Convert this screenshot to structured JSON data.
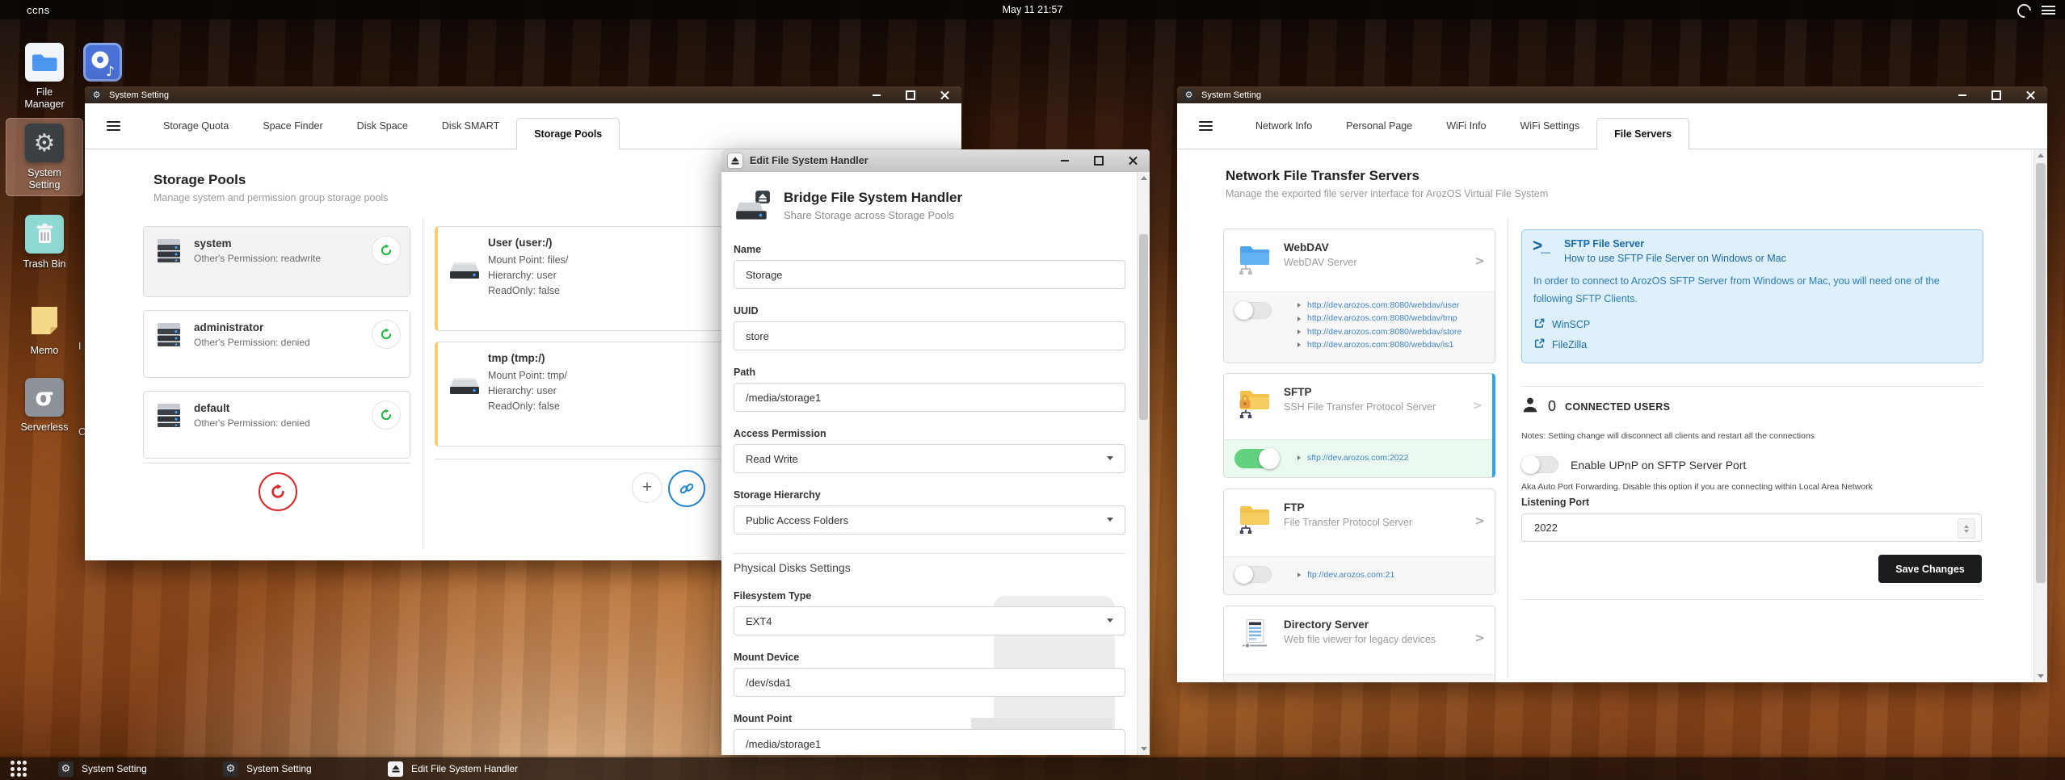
{
  "topbar": {
    "host": "ccns",
    "clock": "May 11 21:57"
  },
  "desktop": {
    "icons": [
      {
        "key": "file-manager",
        "label": "File Manager",
        "selected": false
      },
      {
        "key": "system-setting",
        "label": "System Setting",
        "selected": true
      },
      {
        "key": "trash-bin",
        "label": "Trash Bin",
        "selected": false
      },
      {
        "key": "memo",
        "label": "Memo",
        "selected": false
      },
      {
        "key": "serverless",
        "label": "Serverless",
        "selected": false
      }
    ],
    "music_icon": "music-player",
    "clipped_labels": [
      "I",
      "C"
    ]
  },
  "win1": {
    "title": "System Setting",
    "tabs": [
      "Storage Quota",
      "Space Finder",
      "Disk Space",
      "Disk SMART",
      "Storage Pools"
    ],
    "active_tab": "Storage Pools",
    "heading": "Storage Pools",
    "subheading": "Manage system and permission group storage pools",
    "pools": [
      {
        "name": "system",
        "perm": "Other's Permission: readwrite",
        "selected": true
      },
      {
        "name": "administrator",
        "perm": "Other's Permission: denied",
        "selected": false
      },
      {
        "name": "default",
        "perm": "Other's Permission: denied",
        "selected": false
      }
    ],
    "mounts": [
      {
        "name": "User (user:/)",
        "lines": [
          "Mount Point: files/",
          "Hierarchy: user",
          "ReadOnly: false"
        ]
      },
      {
        "name": "tmp (tmp:/)",
        "lines": [
          "Mount Point: tmp/",
          "Hierarchy: user",
          "ReadOnly: false"
        ]
      }
    ]
  },
  "dialog": {
    "title": "Edit File System Handler",
    "heading": "Bridge File System Handler",
    "subheading": "Share Storage across Storage Pools",
    "fields": [
      {
        "label": "Name",
        "value": "Storage",
        "type": "text"
      },
      {
        "label": "UUID",
        "value": "store",
        "type": "text"
      },
      {
        "label": "Path",
        "value": "/media/storage1",
        "type": "text"
      },
      {
        "label": "Access Permission",
        "value": "Read Write",
        "type": "select"
      },
      {
        "label": "Storage Hierarchy",
        "value": "Public Access Folders",
        "type": "select"
      }
    ],
    "section2": "Physical Disks Settings",
    "fields2": [
      {
        "label": "Filesystem Type",
        "value": "EXT4",
        "type": "select"
      },
      {
        "label": "Mount Device",
        "value": "/dev/sda1",
        "type": "text"
      },
      {
        "label": "Mount Point",
        "value": "/media/storage1",
        "type": "text"
      }
    ]
  },
  "win2": {
    "title": "System Setting",
    "tabs": [
      "Network Info",
      "Personal Page",
      "WiFi Info",
      "WiFi Settings",
      "File Servers"
    ],
    "active_tab": "File Servers",
    "heading": "Network File Transfer Servers",
    "subheading": "Manage the exported file server interface for ArozOS Virtual File System",
    "servers": [
      {
        "icon": "webdav",
        "name": "WebDAV",
        "desc": "WebDAV Server",
        "enabled": false,
        "links": [
          "http://dev.arozos.com:8080/webdav/user",
          "http://dev.arozos.com:8080/webdav/tmp",
          "http://dev.arozos.com:8080/webdav/store",
          "http://dev.arozos.com:8080/webdav/is1"
        ],
        "selected": false
      },
      {
        "icon": "sftp",
        "name": "SFTP",
        "desc": "SSH File Transfer Protocol Server",
        "enabled": true,
        "links": [
          "sftp://dev.arozos.com:2022"
        ],
        "selected": true
      },
      {
        "icon": "ftp",
        "name": "FTP",
        "desc": "File Transfer Protocol Server",
        "enabled": false,
        "links": [
          "ftp://dev.arozos.com:21"
        ],
        "selected": false
      },
      {
        "icon": "dirserver",
        "name": "Directory Server",
        "desc": "Web file viewer for legacy devices",
        "links": [],
        "selected": false
      }
    ],
    "info_box": {
      "title": "SFTP File Server",
      "subtitle": "How to use SFTP File Server on Windows or Mac",
      "body": "In order to connect to ArozOS SFTP Server from Windows or Mac, you will need one of the following SFTP Clients.",
      "clients": [
        "WinSCP",
        "FileZilla"
      ]
    },
    "connected": {
      "count": "0",
      "label": "CONNECTED USERS",
      "notes": "Notes: Setting change will disconnect all clients and restart all the connections"
    },
    "upnp": {
      "label": "Enable UPnP on SFTP Server Port",
      "desc": "Aka Auto Port Forwarding. Disable this option if you are connecting within Local Area Network"
    },
    "port": {
      "label": "Listening Port",
      "value": "2022"
    },
    "save_label": "Save Changes"
  },
  "taskbar": {
    "items": [
      {
        "icon": "gear",
        "label": "System Setting"
      },
      {
        "icon": "gear",
        "label": "System Setting"
      },
      {
        "icon": "eject",
        "label": "Edit File System Handler"
      }
    ]
  },
  "colors": {
    "accent_blue": "#2185d0",
    "link_blue": "#4183c4",
    "toggle_green": "#62d27f",
    "refresh_green": "#21ba45",
    "refresh_red": "#db2828",
    "mount_yellow": "#f5ce6e",
    "info_blue": "#1b6aaa",
    "sftp_border": "#35a4e4",
    "save_dark": "#1b1c1d"
  }
}
